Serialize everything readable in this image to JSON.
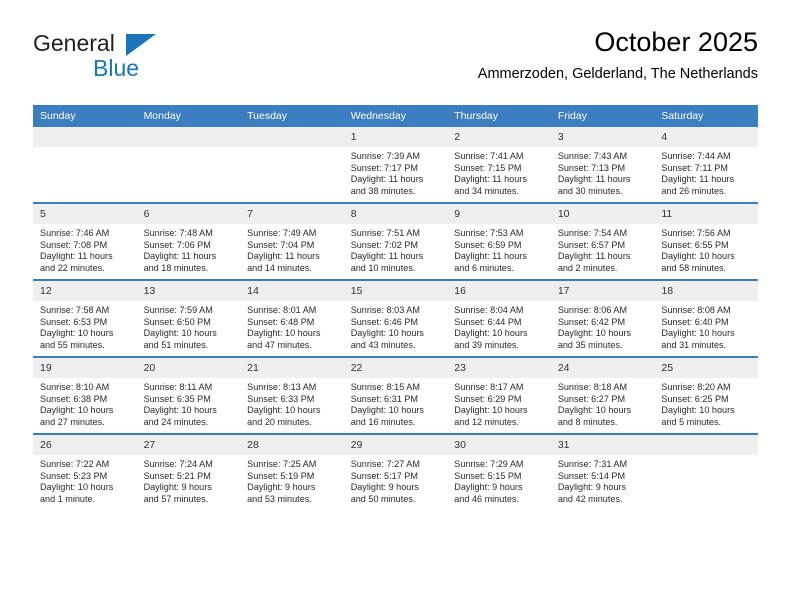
{
  "brand": {
    "name_top": "General",
    "name_bottom": "Blue",
    "accent_color": "#1b75bb"
  },
  "header": {
    "title": "October 2025",
    "subtitle": "Ammerzoden, Gelderland, The Netherlands"
  },
  "theme": {
    "header_blue": "#3b7ebf",
    "date_band_gray": "#efefef",
    "text_color": "#2b2b2b"
  },
  "calendar": {
    "weekday_headers": [
      "Sunday",
      "Monday",
      "Tuesday",
      "Wednesday",
      "Thursday",
      "Friday",
      "Saturday"
    ],
    "weeks": [
      [
        {
          "day": "",
          "lines": []
        },
        {
          "day": "",
          "lines": []
        },
        {
          "day": "",
          "lines": []
        },
        {
          "day": "1",
          "lines": [
            "Sunrise: 7:39 AM",
            "Sunset: 7:17 PM",
            "Daylight: 11 hours",
            "and 38 minutes."
          ]
        },
        {
          "day": "2",
          "lines": [
            "Sunrise: 7:41 AM",
            "Sunset: 7:15 PM",
            "Daylight: 11 hours",
            "and 34 minutes."
          ]
        },
        {
          "day": "3",
          "lines": [
            "Sunrise: 7:43 AM",
            "Sunset: 7:13 PM",
            "Daylight: 11 hours",
            "and 30 minutes."
          ]
        },
        {
          "day": "4",
          "lines": [
            "Sunrise: 7:44 AM",
            "Sunset: 7:11 PM",
            "Daylight: 11 hours",
            "and 26 minutes."
          ]
        }
      ],
      [
        {
          "day": "5",
          "lines": [
            "Sunrise: 7:46 AM",
            "Sunset: 7:08 PM",
            "Daylight: 11 hours",
            "and 22 minutes."
          ]
        },
        {
          "day": "6",
          "lines": [
            "Sunrise: 7:48 AM",
            "Sunset: 7:06 PM",
            "Daylight: 11 hours",
            "and 18 minutes."
          ]
        },
        {
          "day": "7",
          "lines": [
            "Sunrise: 7:49 AM",
            "Sunset: 7:04 PM",
            "Daylight: 11 hours",
            "and 14 minutes."
          ]
        },
        {
          "day": "8",
          "lines": [
            "Sunrise: 7:51 AM",
            "Sunset: 7:02 PM",
            "Daylight: 11 hours",
            "and 10 minutes."
          ]
        },
        {
          "day": "9",
          "lines": [
            "Sunrise: 7:53 AM",
            "Sunset: 6:59 PM",
            "Daylight: 11 hours",
            "and 6 minutes."
          ]
        },
        {
          "day": "10",
          "lines": [
            "Sunrise: 7:54 AM",
            "Sunset: 6:57 PM",
            "Daylight: 11 hours",
            "and 2 minutes."
          ]
        },
        {
          "day": "11",
          "lines": [
            "Sunrise: 7:56 AM",
            "Sunset: 6:55 PM",
            "Daylight: 10 hours",
            "and 58 minutes."
          ]
        }
      ],
      [
        {
          "day": "12",
          "lines": [
            "Sunrise: 7:58 AM",
            "Sunset: 6:53 PM",
            "Daylight: 10 hours",
            "and 55 minutes."
          ]
        },
        {
          "day": "13",
          "lines": [
            "Sunrise: 7:59 AM",
            "Sunset: 6:50 PM",
            "Daylight: 10 hours",
            "and 51 minutes."
          ]
        },
        {
          "day": "14",
          "lines": [
            "Sunrise: 8:01 AM",
            "Sunset: 6:48 PM",
            "Daylight: 10 hours",
            "and 47 minutes."
          ]
        },
        {
          "day": "15",
          "lines": [
            "Sunrise: 8:03 AM",
            "Sunset: 6:46 PM",
            "Daylight: 10 hours",
            "and 43 minutes."
          ]
        },
        {
          "day": "16",
          "lines": [
            "Sunrise: 8:04 AM",
            "Sunset: 6:44 PM",
            "Daylight: 10 hours",
            "and 39 minutes."
          ]
        },
        {
          "day": "17",
          "lines": [
            "Sunrise: 8:06 AM",
            "Sunset: 6:42 PM",
            "Daylight: 10 hours",
            "and 35 minutes."
          ]
        },
        {
          "day": "18",
          "lines": [
            "Sunrise: 8:08 AM",
            "Sunset: 6:40 PM",
            "Daylight: 10 hours",
            "and 31 minutes."
          ]
        }
      ],
      [
        {
          "day": "19",
          "lines": [
            "Sunrise: 8:10 AM",
            "Sunset: 6:38 PM",
            "Daylight: 10 hours",
            "and 27 minutes."
          ]
        },
        {
          "day": "20",
          "lines": [
            "Sunrise: 8:11 AM",
            "Sunset: 6:35 PM",
            "Daylight: 10 hours",
            "and 24 minutes."
          ]
        },
        {
          "day": "21",
          "lines": [
            "Sunrise: 8:13 AM",
            "Sunset: 6:33 PM",
            "Daylight: 10 hours",
            "and 20 minutes."
          ]
        },
        {
          "day": "22",
          "lines": [
            "Sunrise: 8:15 AM",
            "Sunset: 6:31 PM",
            "Daylight: 10 hours",
            "and 16 minutes."
          ]
        },
        {
          "day": "23",
          "lines": [
            "Sunrise: 8:17 AM",
            "Sunset: 6:29 PM",
            "Daylight: 10 hours",
            "and 12 minutes."
          ]
        },
        {
          "day": "24",
          "lines": [
            "Sunrise: 8:18 AM",
            "Sunset: 6:27 PM",
            "Daylight: 10 hours",
            "and 8 minutes."
          ]
        },
        {
          "day": "25",
          "lines": [
            "Sunrise: 8:20 AM",
            "Sunset: 6:25 PM",
            "Daylight: 10 hours",
            "and 5 minutes."
          ]
        }
      ],
      [
        {
          "day": "26",
          "lines": [
            "Sunrise: 7:22 AM",
            "Sunset: 5:23 PM",
            "Daylight: 10 hours",
            "and 1 minute."
          ]
        },
        {
          "day": "27",
          "lines": [
            "Sunrise: 7:24 AM",
            "Sunset: 5:21 PM",
            "Daylight: 9 hours",
            "and 57 minutes."
          ]
        },
        {
          "day": "28",
          "lines": [
            "Sunrise: 7:25 AM",
            "Sunset: 5:19 PM",
            "Daylight: 9 hours",
            "and 53 minutes."
          ]
        },
        {
          "day": "29",
          "lines": [
            "Sunrise: 7:27 AM",
            "Sunset: 5:17 PM",
            "Daylight: 9 hours",
            "and 50 minutes."
          ]
        },
        {
          "day": "30",
          "lines": [
            "Sunrise: 7:29 AM",
            "Sunset: 5:15 PM",
            "Daylight: 9 hours",
            "and 46 minutes."
          ]
        },
        {
          "day": "31",
          "lines": [
            "Sunrise: 7:31 AM",
            "Sunset: 5:14 PM",
            "Daylight: 9 hours",
            "and 42 minutes."
          ]
        },
        {
          "day": "",
          "lines": []
        }
      ]
    ]
  }
}
